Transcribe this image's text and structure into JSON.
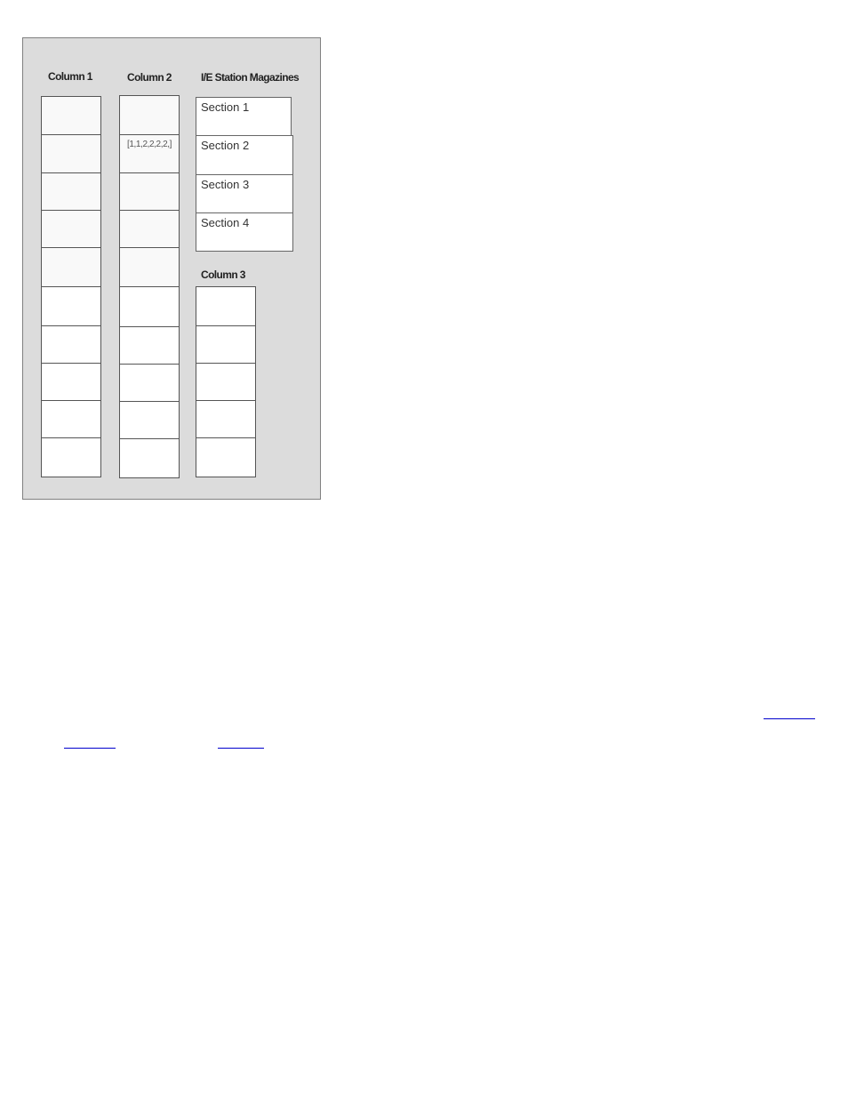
{
  "diagram": {
    "headers": {
      "column1": "Column 1",
      "column2": "Column 2",
      "magazines": "I/E Station Magazines",
      "column3": "Column 3"
    },
    "column1": {
      "cells": [
        "",
        "",
        "",
        "",
        "",
        "",
        "",
        "",
        "",
        ""
      ]
    },
    "column2": {
      "cells": [
        "",
        "[1,1,2,2,2,2,]",
        "",
        "",
        "",
        "",
        "",
        "",
        "",
        ""
      ]
    },
    "magazines": {
      "sections": [
        "Section 1",
        "Section 2",
        "Section 3",
        "Section 4"
      ]
    },
    "column3": {
      "cells": [
        "",
        "",
        "",
        "",
        ""
      ]
    },
    "colors": {
      "panel_bg": "#dcdcdc",
      "cell_border": "#555555",
      "link": "#0000cc"
    }
  },
  "bullets": {
    "items": [
      "",
      "",
      "",
      "",
      ""
    ],
    "links": [
      "",
      "",
      ""
    ]
  }
}
